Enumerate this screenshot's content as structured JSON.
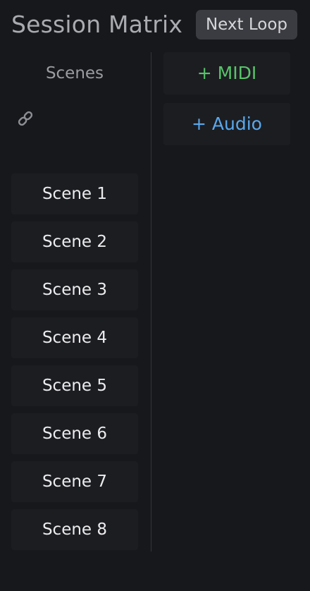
{
  "header": {
    "title": "Session Matrix",
    "next_loop_label": "Next Loop"
  },
  "scenes": {
    "header_label": "Scenes",
    "link_icon": "link-icon",
    "items": [
      {
        "label": "Scene 1"
      },
      {
        "label": "Scene 2"
      },
      {
        "label": "Scene 3"
      },
      {
        "label": "Scene 4"
      },
      {
        "label": "Scene 5"
      },
      {
        "label": "Scene 6"
      },
      {
        "label": "Scene 7"
      },
      {
        "label": "Scene 8"
      }
    ]
  },
  "tracks": {
    "add_midi_label": "+ MIDI",
    "add_audio_label": "+ Audio"
  },
  "colors": {
    "background": "#17181c",
    "midi_accent": "#58c46a",
    "audio_accent": "#5aa8ec",
    "button_bg": "#1c1d21"
  }
}
